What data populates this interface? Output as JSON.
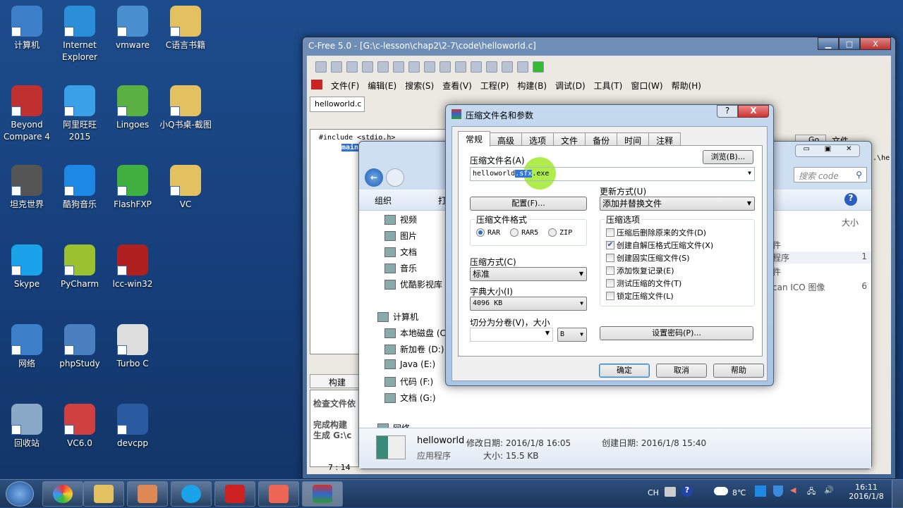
{
  "desktop": {
    "icons": [
      {
        "label": "计算机",
        "color": "#3d7fc8"
      },
      {
        "label": "Internet Explorer",
        "color": "#2a8fd8"
      },
      {
        "label": "vmware",
        "color": "#4a8fd0"
      },
      {
        "label": "C语言书籍",
        "color": "#e3c060"
      },
      {
        "label": "Beyond Compare 4",
        "color": "#c03030"
      },
      {
        "label": "阿里旺旺 2015",
        "color": "#3aa0e8"
      },
      {
        "label": "Lingoes",
        "color": "#5ab040"
      },
      {
        "label": "小Q书桌-截图",
        "color": "#e3c060"
      },
      {
        "label": "坦克世界",
        "color": "#555"
      },
      {
        "label": "酷狗音乐",
        "color": "#1e88e5"
      },
      {
        "label": "FlashFXP",
        "color": "#40b040"
      },
      {
        "label": "VC",
        "color": "#e3c060"
      },
      {
        "label": "Skype",
        "color": "#1aa3e8"
      },
      {
        "label": "PyCharm",
        "color": "#9bc030"
      },
      {
        "label": "lcc-win32",
        "color": "#b02020"
      },
      {
        "label": "网络",
        "color": "#3d7fc8"
      },
      {
        "label": "phpStudy",
        "color": "#4a80c0"
      },
      {
        "label": "Turbo C",
        "color": "#ddd"
      },
      {
        "label": "回收站",
        "color": "#8aa8c8"
      },
      {
        "label": "VC6.0",
        "color": "#d04040"
      },
      {
        "label": "devcpp",
        "color": "#2a5aa0"
      }
    ]
  },
  "cfree": {
    "title": "C-Free 5.0 - [G:\\c-lesson\\chap2\\2-7\\code\\helloworld.c]",
    "menu": [
      "文件(F)",
      "编辑(E)",
      "搜索(S)",
      "查看(V)",
      "工程(P)",
      "构建(B)",
      "调试(D)",
      "工具(T)",
      "窗口(W)",
      "帮助(H)"
    ],
    "tab": "helloworld.c",
    "tree": [
      "#include <stdio.h>",
      "main"
    ],
    "go": "Go",
    "files_label": "文件...",
    "files_item": "...\\he",
    "build_tab": "构建",
    "build_lines": [
      "检查文件依",
      "完成构建",
      "生成 G:\\c"
    ],
    "cursor_pos": "7 : 14"
  },
  "explorer": {
    "search_placeholder": "搜索 code",
    "organize": "组织",
    "open": "打",
    "nav": [
      "视频",
      "图片",
      "文档",
      "音乐",
      "优酷影视库",
      "计算机",
      "本地磁盘 (C",
      "新加卷 (D:)",
      "Java (E:)",
      "代码 (F:)",
      "文档 (G:)",
      "网络"
    ],
    "col_size": "大小",
    "rows": [
      "件",
      "程序",
      "件",
      "can ICO 图像"
    ],
    "sizes": [
      "1",
      "6"
    ],
    "details": {
      "name": "helloworld",
      "type": "应用程序",
      "modified": "修改日期: 2016/1/8 16:05",
      "size": "大小: 15.5 KB",
      "created": "创建日期: 2016/1/8 15:40"
    }
  },
  "dialog": {
    "title": "压缩文件名和参数",
    "tabs": [
      "常规",
      "高级",
      "选项",
      "文件",
      "备份",
      "时间",
      "注释"
    ],
    "archive_label": "压缩文件名(A)",
    "archive_pre": "helloworld",
    "archive_sel": ".sfx",
    "archive_post": ".exe",
    "browse": "浏览(B)...",
    "update_label": "更新方式(U)",
    "update_value": "添加并替换文件",
    "profiles": "配置(F)...",
    "format_label": "压缩文件格式",
    "formats": [
      {
        "label": "RAR",
        "checked": true
      },
      {
        "label": "RAR5",
        "checked": false
      },
      {
        "label": "ZIP",
        "checked": false
      }
    ],
    "method_label": "压缩方式(C)",
    "method_value": "标准",
    "dict_label": "字典大小(I)",
    "dict_value": "4096 KB",
    "split_label": "切分为分卷(V)，大小",
    "split_value": "",
    "split_unit": "B",
    "options_label": "压缩选项",
    "options": [
      {
        "label": "压缩后删除原来的文件(D)",
        "checked": false
      },
      {
        "label": "创建自解压格式压缩文件(X)",
        "checked": true
      },
      {
        "label": "创建固实压缩文件(S)",
        "checked": false
      },
      {
        "label": "添加恢复记录(E)",
        "checked": false
      },
      {
        "label": "测试压缩的文件(T)",
        "checked": false
      },
      {
        "label": "锁定压缩文件(L)",
        "checked": false
      }
    ],
    "password": "设置密码(P)...",
    "ok": "确定",
    "cancel": "取消",
    "help": "帮助"
  },
  "taskbar": {
    "lang": "CH",
    "temp": "8℃",
    "time": "16:11",
    "date": "2016/1/8"
  }
}
